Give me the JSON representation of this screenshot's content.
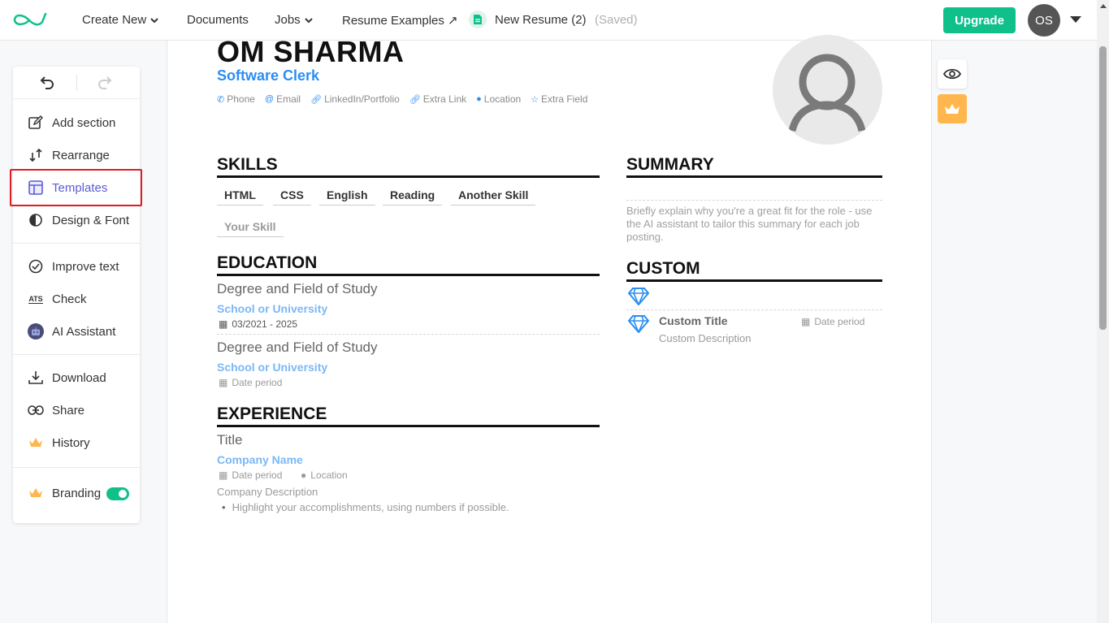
{
  "nav": {
    "create_new": "Create New",
    "documents": "Documents",
    "jobs": "Jobs",
    "resume_examples": "Resume Examples ↗",
    "doc_name": "New Resume (2)",
    "saved": "(Saved)",
    "upgrade": "Upgrade",
    "avatar_initials": "OS"
  },
  "sidebar": {
    "items": [
      {
        "label": "Add section",
        "icon": "edit-icon"
      },
      {
        "label": "Rearrange",
        "icon": "rearrange-icon"
      },
      {
        "label": "Templates",
        "icon": "template-icon"
      },
      {
        "label": "Design & Font",
        "icon": "contrast-icon"
      },
      {
        "label": "Improve text",
        "icon": "check-circle-icon"
      },
      {
        "label": "Check",
        "icon": "ats-icon"
      },
      {
        "label": "AI Assistant",
        "icon": "robot-icon"
      },
      {
        "label": "Download",
        "icon": "download-icon"
      },
      {
        "label": "Share",
        "icon": "link-icon"
      },
      {
        "label": "History",
        "icon": "crown-icon"
      },
      {
        "label": "Branding",
        "icon": "crown-icon"
      }
    ],
    "ats_text": "ATS",
    "branding_enabled": true,
    "accent": "#5b5bd6",
    "highlight": "#e01b24"
  },
  "resume": {
    "name": "OM SHARMA",
    "title": "Software Clerk",
    "contacts": [
      "Phone",
      "Email",
      "LinkedIn/Portfolio",
      "Extra Link",
      "Location",
      "Extra Field"
    ],
    "sections": {
      "skills": "SKILLS",
      "summary": "SUMMARY",
      "education": "EDUCATION",
      "custom": "CUSTOM",
      "experience": "EXPERIENCE"
    },
    "skills": [
      "HTML",
      "CSS",
      "English",
      "Reading",
      "Another Skill",
      "Your Skill"
    ],
    "summary_placeholder": "Briefly explain why you're a great fit for the role - use the AI assistant to tailor this summary for each job posting.",
    "education": [
      {
        "degree": "Degree and Field of Study",
        "school": "School or University",
        "period": "03/2021 - 2025"
      },
      {
        "degree": "Degree and Field of Study",
        "school": "School or University",
        "period": "Date period"
      }
    ],
    "custom": {
      "title": "Custom Title",
      "description": "Custom Description",
      "period": "Date period"
    },
    "experience": {
      "title": "Title",
      "company": "Company Name",
      "period": "Date period",
      "location": "Location",
      "description": "Company Description",
      "bullet": "Highlight your accomplishments, using numbers if possible."
    },
    "accent": "#2b8ef2"
  },
  "colors": {
    "brand_green": "#10c08b",
    "crown_orange": "#ffb74d"
  }
}
